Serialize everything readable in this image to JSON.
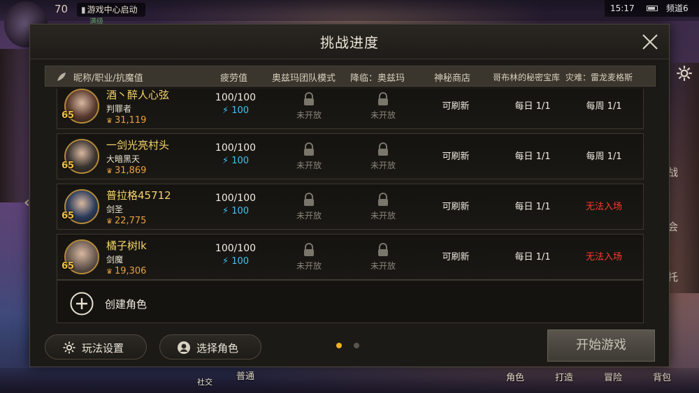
{
  "background": {
    "player_level": "70",
    "game_center_label": "游戏中心启动",
    "full_level_label": "满级",
    "status_time": "15:17",
    "channel": "频道6",
    "right_labels": [
      "战",
      "会",
      "托"
    ],
    "bottom_labels": [
      "社交",
      "普通",
      "角色",
      "打造",
      "冒险",
      "背包"
    ]
  },
  "dialog": {
    "title": "挑战进度",
    "columns": {
      "name": "昵称/职业/抗魔值",
      "fatigue": "疲劳值",
      "ozma_raid": "奥兹玛团队模式",
      "descent": "降临：奥兹玛",
      "mystery_shop": "神秘商店",
      "goblin_vault": "哥布林的秘密宝库",
      "calamity": "灾难：雷龙麦格斯"
    },
    "rows": [
      {
        "level": "65",
        "name": "酒丶醉人心弦",
        "class": "判罪者",
        "power": "31,119",
        "fatigue": "100/100",
        "energy": "100",
        "ozma_raid": "未开放",
        "descent": "未开放",
        "mystery_shop": "可刷新",
        "goblin_vault": "每日 1/1",
        "calamity": "每周 1/1",
        "calamity_blocked": false,
        "portrait_color": "#5a3a2e"
      },
      {
        "level": "65",
        "name": "一剑光亮村头",
        "class": "大暗黑天",
        "power": "31,869",
        "fatigue": "100/100",
        "energy": "100",
        "ozma_raid": "未开放",
        "descent": "未开放",
        "mystery_shop": "可刷新",
        "goblin_vault": "每日 1/1",
        "calamity": "每周 1/1",
        "calamity_blocked": false,
        "portrait_color": "#3a3430"
      },
      {
        "level": "65",
        "name": "普拉格45712",
        "class": "剑圣",
        "power": "22,775",
        "fatigue": "100/100",
        "energy": "100",
        "ozma_raid": "未开放",
        "descent": "未开放",
        "mystery_shop": "可刷新",
        "goblin_vault": "每日 1/1",
        "calamity": "无法入场",
        "calamity_blocked": true,
        "portrait_color": "#2a3a5a"
      },
      {
        "level": "65",
        "name": "橘子树lk",
        "class": "剑魔",
        "power": "19,306",
        "fatigue": "100/100",
        "energy": "100",
        "ozma_raid": "未开放",
        "descent": "未开放",
        "mystery_shop": "可刷新",
        "goblin_vault": "每日 1/1",
        "calamity": "无法入场",
        "calamity_blocked": true,
        "portrait_color": "#6a5a52"
      }
    ],
    "create_role": "创建角色",
    "footer": {
      "play_settings": "玩法设置",
      "select_role": "选择角色",
      "start_game": "开始游戏",
      "pages": 2,
      "current_page": 1
    },
    "colors": {
      "gold_text": "#f5d46a",
      "energy_blue": "#44c0f0",
      "blocked_red": "#ff3a2a",
      "active_dot": "#f0b020",
      "inactive_dot": "#5a564e"
    },
    "icons": {
      "close": "close-icon",
      "lock": "lock-icon",
      "plus": "plus-icon",
      "gear": "gear-icon",
      "character": "character-icon",
      "energy": "lightning-icon",
      "crown": "crown-icon"
    }
  }
}
